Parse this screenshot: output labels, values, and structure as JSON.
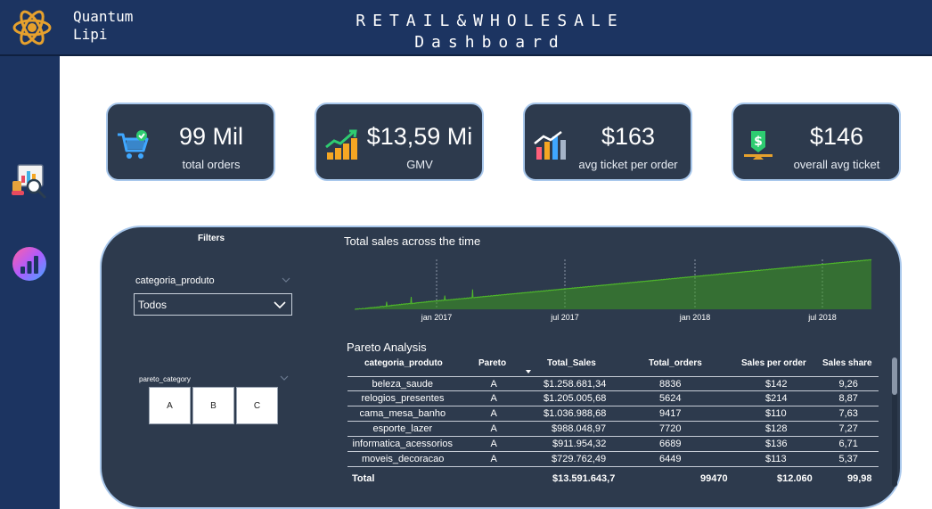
{
  "header": {
    "brand": [
      "Quantum",
      "Lipi"
    ],
    "title": [
      "RETAIL&WHOLESALE",
      "Dashboard"
    ]
  },
  "kpis": [
    {
      "value": "99 Mil",
      "label": "total orders",
      "icon": "shopping-cart-icon"
    },
    {
      "value": "$13,59 Mi",
      "label": "GMV",
      "icon": "money-growth-icon"
    },
    {
      "value": "$163",
      "label": "avg ticket per order",
      "icon": "bar-chart-icon"
    },
    {
      "value": "$146",
      "label": "overall avg ticket",
      "icon": "dollar-balance-icon"
    }
  ],
  "filters": {
    "title": "Filters",
    "categoria_label": "categoria_produto",
    "categoria_value": "Todos",
    "pareto_label": "pareto_category",
    "pareto_options": [
      "A",
      "B",
      "C"
    ]
  },
  "chart_data": {
    "type": "line",
    "title": "Total sales across the time",
    "x_ticks": [
      "jan 2017",
      "jul 2017",
      "jan 2018",
      "jul 2018"
    ],
    "color": "#3d9a1f",
    "series": [
      {
        "values": [
          0,
          0,
          0,
          2,
          1,
          0,
          2,
          1,
          1,
          3,
          2,
          2,
          1,
          2,
          3,
          2,
          4,
          3,
          2,
          3,
          4,
          3,
          5,
          4,
          5,
          4,
          6,
          5,
          5,
          7,
          6,
          7,
          5,
          6,
          8,
          7,
          6,
          8,
          7,
          9,
          8,
          7,
          9,
          8,
          10,
          9,
          8,
          10,
          9,
          11,
          12,
          10,
          11,
          13,
          11,
          10,
          12,
          11,
          13,
          12,
          11,
          30,
          14,
          12,
          13,
          15,
          14,
          13,
          16,
          15,
          14,
          17,
          16,
          15,
          17,
          16,
          18,
          17,
          16,
          18,
          17,
          19,
          18,
          17,
          19,
          18,
          20,
          19,
          18,
          21,
          20,
          19,
          21,
          20,
          22,
          21,
          20,
          22,
          21,
          23,
          22,
          21,
          23,
          22,
          24,
          23,
          22,
          24,
          50,
          22,
          23,
          24,
          25,
          24,
          23,
          25,
          26,
          24,
          25,
          27,
          26,
          25,
          27,
          26,
          28,
          27,
          26,
          28,
          27,
          29,
          28,
          27,
          29,
          28,
          30,
          29,
          28,
          31,
          30,
          29,
          31,
          30,
          32,
          31,
          30,
          32,
          31,
          33,
          32,
          31,
          33,
          32,
          34,
          33,
          32,
          34,
          33,
          35,
          34,
          33,
          35,
          34,
          36,
          35,
          34,
          36,
          35,
          37,
          36,
          35,
          37,
          36,
          55,
          37,
          36,
          38,
          37,
          36,
          38,
          37,
          39,
          38,
          37,
          39,
          38,
          40,
          39,
          38,
          40,
          39,
          41,
          40,
          39,
          41,
          40,
          42,
          41,
          40,
          42,
          41,
          43,
          42,
          41,
          43,
          42,
          44,
          43,
          42,
          44,
          43,
          45,
          44,
          43,
          45,
          44,
          46,
          45,
          44,
          46,
          45,
          47,
          46,
          45,
          47,
          46,
          80,
          48,
          47,
          46,
          48,
          47,
          49,
          48,
          47,
          49,
          48,
          50,
          49,
          48,
          50,
          49,
          51,
          50,
          49,
          51,
          50,
          52,
          51,
          50,
          52,
          51,
          53,
          52,
          51,
          53,
          52,
          54,
          53,
          52,
          54,
          53,
          55,
          54,
          53,
          55,
          54,
          56,
          55,
          54,
          56,
          55,
          57,
          56,
          55,
          57,
          56,
          58,
          57,
          56,
          58,
          57,
          59,
          58,
          57,
          59,
          58,
          60,
          59,
          58,
          60,
          59,
          61,
          60,
          59,
          61,
          60,
          62,
          61,
          60,
          62,
          61,
          63,
          62,
          61,
          63,
          62,
          64,
          63,
          62,
          64,
          63,
          65,
          64,
          63,
          65,
          64,
          66,
          65,
          64,
          66,
          65,
          67,
          66,
          65,
          67,
          66,
          68,
          67,
          66,
          68,
          67,
          69,
          68,
          67,
          69,
          68,
          70,
          69,
          68,
          70,
          69,
          71,
          70,
          69,
          71,
          70,
          72,
          71,
          70,
          72,
          71,
          73,
          72,
          71,
          73,
          72,
          74,
          73,
          72,
          74,
          73,
          75,
          74,
          73,
          75,
          74,
          76,
          75,
          74,
          76,
          75,
          77,
          76,
          75,
          77,
          76,
          78,
          77,
          76,
          78,
          77,
          79,
          78,
          77,
          79,
          78,
          80,
          79,
          78,
          80,
          79,
          81,
          80,
          79,
          81,
          80,
          82,
          81,
          80,
          82,
          81,
          83,
          82,
          81,
          83,
          82,
          84,
          83,
          82,
          84,
          83,
          85,
          84,
          83,
          85,
          84,
          86,
          85,
          84,
          86,
          85,
          87,
          86,
          85,
          87,
          86,
          88,
          87,
          86,
          88,
          87,
          89,
          88,
          87,
          89,
          88,
          90,
          89,
          88,
          90,
          89,
          91,
          90,
          89,
          91,
          90,
          92,
          91,
          90,
          92,
          91,
          93,
          92,
          91,
          93,
          92,
          94,
          93,
          92,
          94,
          93,
          95,
          94,
          93,
          95,
          94,
          96,
          95,
          94,
          96,
          95,
          97,
          96,
          95,
          97,
          96,
          98,
          97,
          96,
          98,
          97,
          99,
          98,
          97,
          99,
          98,
          100,
          99,
          98,
          100,
          99,
          101,
          100,
          99,
          101,
          100,
          102,
          101,
          100,
          102,
          101,
          103,
          102,
          101,
          103,
          102,
          104,
          103,
          102,
          104,
          103,
          105,
          104,
          103,
          105,
          104,
          106,
          105,
          104,
          106,
          105,
          107,
          106,
          105,
          107,
          106,
          108,
          107,
          106,
          108,
          107,
          109,
          108,
          107,
          109,
          108,
          110,
          109,
          108,
          110,
          109,
          111,
          110,
          109,
          111,
          110,
          112,
          111,
          110,
          112,
          111,
          113,
          112,
          111,
          113,
          112,
          114,
          113,
          112,
          114,
          113,
          115,
          114,
          113,
          115,
          114,
          116,
          115,
          114,
          116,
          115,
          117,
          116,
          115,
          117,
          116,
          118,
          117,
          116,
          118,
          117,
          119,
          118,
          117,
          119,
          118,
          120,
          119,
          118,
          120,
          119,
          121,
          120,
          119,
          121,
          120,
          122,
          121,
          120,
          122,
          121,
          123,
          122,
          121,
          123,
          122,
          124,
          123,
          122,
          124,
          123,
          125,
          124,
          123,
          125,
          124,
          126,
          125,
          124,
          126,
          125,
          127,
          126,
          125,
          127,
          126,
          128,
          127,
          126,
          128,
          127,
          129,
          128,
          127,
          129,
          128,
          130,
          129,
          128,
          130,
          129,
          131,
          130,
          129,
          131,
          130,
          132,
          131,
          130,
          132,
          131,
          133,
          132,
          131,
          133,
          132,
          134,
          133,
          132,
          134,
          133,
          135,
          134,
          133,
          135,
          134,
          136,
          135,
          134,
          136,
          135,
          137,
          136,
          135,
          137,
          136,
          138,
          137,
          136,
          138,
          137,
          139,
          138,
          137,
          139,
          138,
          140,
          139,
          138,
          140,
          139,
          141,
          140,
          139,
          141,
          140,
          142,
          141,
          140,
          142,
          141,
          143,
          142,
          141,
          143,
          142,
          144,
          143,
          142,
          144,
          143,
          145,
          144,
          143,
          145,
          144,
          146,
          145,
          144,
          146,
          145,
          147,
          146,
          145,
          147,
          146,
          148,
          147,
          146,
          148,
          147,
          149,
          148,
          147,
          149,
          148,
          150,
          149,
          148,
          150,
          149,
          151,
          150,
          149,
          151,
          150,
          152,
          151,
          150,
          152,
          151,
          153,
          152,
          151,
          153,
          152,
          154,
          153,
          152,
          154,
          153,
          155,
          154,
          153,
          155,
          154,
          156,
          155,
          154,
          156,
          155,
          157,
          156,
          155,
          157,
          156,
          158,
          157,
          156,
          158,
          157,
          159,
          158,
          157,
          159,
          158,
          160,
          159,
          158,
          160,
          159,
          161,
          160,
          159,
          161,
          160,
          162,
          161,
          160,
          162,
          161,
          163,
          162,
          161,
          163,
          162,
          164,
          163,
          162,
          164,
          163,
          165,
          164,
          163,
          165,
          164,
          166,
          165,
          164,
          166,
          165,
          167,
          166,
          165,
          167,
          166,
          168,
          167,
          166,
          168,
          167,
          169,
          168,
          167,
          169,
          168,
          170,
          169,
          168,
          170,
          169,
          171,
          170,
          169,
          171,
          170,
          172,
          171,
          170,
          172,
          171,
          173,
          172,
          171,
          173,
          172,
          174,
          173,
          172,
          174,
          173,
          175,
          174,
          173,
          175,
          174,
          176,
          175,
          174,
          176,
          175,
          177,
          176,
          175,
          177,
          176,
          178,
          177,
          176,
          178,
          177,
          179,
          178,
          177,
          179,
          178,
          180,
          179,
          178,
          180,
          179,
          181,
          180,
          179,
          181,
          180,
          182,
          181,
          180,
          182,
          181,
          183,
          182,
          181,
          183,
          182,
          184,
          183,
          182,
          184,
          183,
          185,
          184,
          183,
          185,
          184,
          186,
          185,
          184,
          186,
          185,
          187,
          186,
          185,
          187,
          186,
          188,
          187,
          186,
          188,
          187,
          189,
          188,
          187,
          189,
          188,
          190,
          189,
          188,
          190,
          189,
          191,
          190,
          189,
          191,
          190,
          192,
          191,
          190,
          192,
          191,
          193,
          192,
          191,
          193,
          192,
          194,
          193,
          192,
          194,
          193,
          195,
          194,
          193,
          195,
          194,
          196,
          195,
          194,
          196,
          195,
          197,
          196,
          195,
          197,
          196,
          198,
          197,
          196,
          198,
          197,
          199,
          198,
          197,
          199,
          198,
          200
        ]
      }
    ]
  },
  "pareto": {
    "title": "Pareto Analysis",
    "columns": [
      "categoria_produto",
      "Pareto",
      "Total_Sales",
      "Total_orders",
      "Sales per order",
      "Sales share"
    ],
    "rows": [
      [
        "beleza_saude",
        "A",
        "$1.258.681,34",
        "8836",
        "$142",
        "9,26"
      ],
      [
        "relogios_presentes",
        "A",
        "$1.205.005,68",
        "5624",
        "$214",
        "8,87"
      ],
      [
        "cama_mesa_banho",
        "A",
        "$1.036.988,68",
        "9417",
        "$110",
        "7,63"
      ],
      [
        "esporte_lazer",
        "A",
        "$988.048,97",
        "7720",
        "$128",
        "7,27"
      ],
      [
        "informatica_acessorios",
        "A",
        "$911.954,32",
        "6689",
        "$136",
        "6,71"
      ],
      [
        "moveis_decoracao",
        "A",
        "$729.762,49",
        "6449",
        "$113",
        "5,37"
      ]
    ],
    "total": [
      "Total",
      "",
      "$13.591.643,7",
      "99470",
      "$12.060",
      "99,98"
    ]
  }
}
